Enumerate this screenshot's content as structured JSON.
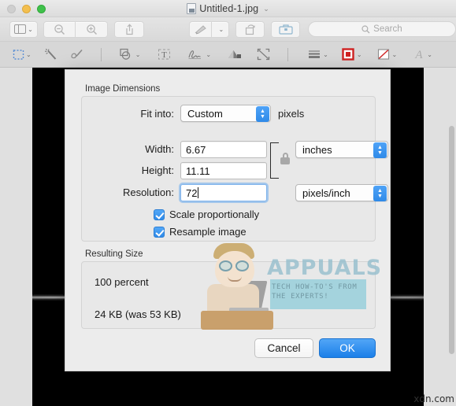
{
  "window": {
    "title": "Untitled-1.jpg",
    "title_chevron": "⌄",
    "traffic_lights": [
      "close",
      "minimize",
      "maximize"
    ]
  },
  "toolbar_primary": {
    "sidebar_label": "sidebar-view",
    "zoom_out_label": "zoom-out",
    "zoom_in_label": "zoom-in",
    "share_label": "share",
    "markup_label": "markup",
    "rotate_label": "rotate",
    "toolkit_label": "toolbox",
    "search_placeholder": "Search"
  },
  "toolbar_markup": {
    "items": [
      "rectangular-selection",
      "instant-alpha",
      "sketch",
      "shapes",
      "text",
      "sign",
      "adjust-color",
      "adjust-size",
      "shape-style",
      "border-color",
      "fill-color",
      "text-style"
    ]
  },
  "dialog": {
    "group_dimensions_title": "Image Dimensions",
    "fit_into_label": "Fit into:",
    "fit_into_value": "Custom",
    "fit_into_unit": "pixels",
    "width_label": "Width:",
    "width_value": "6.67",
    "height_label": "Height:",
    "height_value": "11.11",
    "size_unit_value": "inches",
    "resolution_label": "Resolution:",
    "resolution_value": "72",
    "resolution_unit_value": "pixels/inch",
    "checkbox_scale_label": "Scale proportionally",
    "checkbox_resample_label": "Resample image",
    "group_resulting_title": "Resulting Size",
    "resulting_percent": "100 percent",
    "resulting_size": "24 KB (was 53 KB)",
    "cancel_label": "Cancel",
    "ok_label": "OK",
    "accent_color": "#2f8ae8"
  },
  "watermark": {
    "brand": "APPUALS",
    "tagline_line1": "TECH HOW-TO'S FROM",
    "tagline_line2": "THE EXPERTS!",
    "corner": "xdn.com"
  }
}
